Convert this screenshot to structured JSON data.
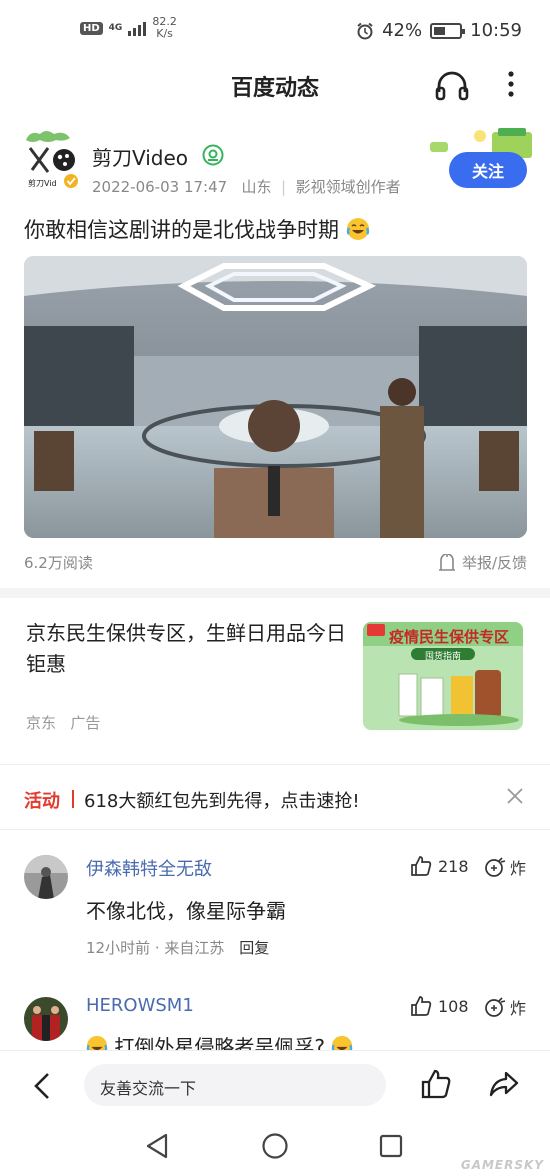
{
  "status_bar": {
    "hd": "HD",
    "network": "4G",
    "speed_value": "82.2",
    "speed_unit": "K/s",
    "battery": "42%",
    "time": "10:59"
  },
  "header": {
    "title": "百度动态",
    "icons": [
      "headphones-icon",
      "more-vertical-icon"
    ]
  },
  "author": {
    "name": "剪刀Video",
    "date": "2022-06-03 17:47",
    "location": "山东",
    "divider": "|",
    "role": "影视领域创作者",
    "follow_label": "关注"
  },
  "post": {
    "title": "你敢相信这剧讲的是北伐战争时期",
    "reads": "6.2万阅读",
    "report_label": "举报/反馈"
  },
  "ad": {
    "text": "京东民生保供专区，生鲜日用品今日钜惠",
    "source": "京东",
    "tag": "广告",
    "image_banner": "疫情民生保供专区",
    "image_subtitle": "囤货指南"
  },
  "promo": {
    "tag": "活动",
    "text": "618大额红包先到先得，点击速抢!"
  },
  "comments": [
    {
      "name": "伊森韩特全无敌",
      "likes": "218",
      "zha": "炸",
      "text": "不像北伐，像星际争霸",
      "time": "12小时前",
      "location": "来自江苏",
      "reply": "回复"
    },
    {
      "name": "HEROWSM1",
      "likes": "108",
      "zha": "炸",
      "text": "打倒外星侵略者吴佩孚?"
    }
  ],
  "bottom_bar": {
    "input_placeholder": "友善交流一下"
  },
  "watermark": "GAMERSKY",
  "colors": {
    "accent_blue": "#3a6cf0",
    "promo_red": "#e33a2e",
    "username_blue": "#4a6bb0",
    "verified_green": "#35b35f"
  }
}
